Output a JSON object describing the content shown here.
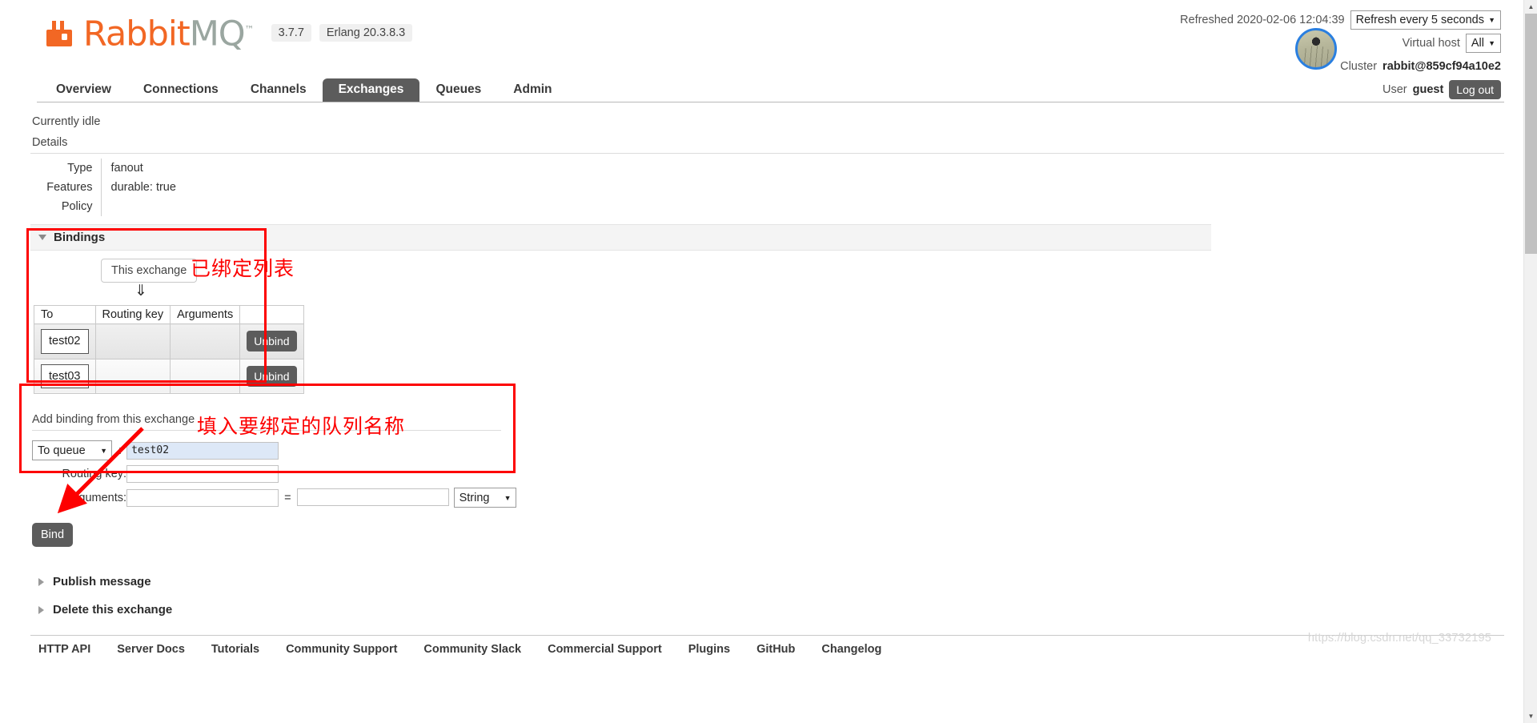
{
  "header": {
    "logo_rabbit": "Rabbit",
    "logo_mq": "MQ",
    "logo_tm": "™",
    "version": "3.7.7",
    "erlang": "Erlang 20.3.8.3",
    "refreshed_label": "Refreshed 2020-02-06 12:04:39",
    "refresh_select": "Refresh every 5 seconds",
    "vhost_label": "Virtual host",
    "vhost_select": "All",
    "cluster_label": "Cluster",
    "cluster_value": "rabbit@859cf94a10e2",
    "user_label": "User",
    "user_value": "guest",
    "logout_label": "Log out"
  },
  "nav": {
    "tabs": [
      {
        "label": "Overview",
        "active": false
      },
      {
        "label": "Connections",
        "active": false
      },
      {
        "label": "Channels",
        "active": false
      },
      {
        "label": "Exchanges",
        "active": true
      },
      {
        "label": "Queues",
        "active": false
      },
      {
        "label": "Admin",
        "active": false
      }
    ]
  },
  "main": {
    "status": "Currently idle",
    "details_heading": "Details",
    "details": [
      {
        "key": "Type",
        "value": "fanout"
      },
      {
        "key": "Features",
        "value": "durable: true"
      },
      {
        "key": "Policy",
        "value": ""
      }
    ],
    "features_key": "durable:",
    "features_val": "true"
  },
  "bindings": {
    "section_label": "Bindings",
    "this_exchange": "This exchange",
    "arrow_glyph": "⇓",
    "columns": [
      "To",
      "Routing key",
      "Arguments",
      ""
    ],
    "rows": [
      {
        "to": "test02",
        "routing_key": "",
        "arguments": "",
        "action": "Unbind"
      },
      {
        "to": "test03",
        "routing_key": "",
        "arguments": "",
        "action": "Unbind"
      }
    ]
  },
  "add_binding": {
    "title": "Add binding from this exchange",
    "destination_select": "To queue",
    "colon": ":",
    "destination_value": "test02",
    "routing_key_label": "Routing key:",
    "routing_key_value": "",
    "arguments_label": "Arguments:",
    "argument_key_value": "",
    "equals": "=",
    "argument_val_value": "",
    "type_select": "String",
    "bind_label": "Bind"
  },
  "sections": [
    {
      "label": "Publish message"
    },
    {
      "label": "Delete this exchange"
    }
  ],
  "annotations": {
    "bound_list": "已绑定列表",
    "fill_queue_name": "填入要绑定的队列名称",
    "color": "#fd0000"
  },
  "footer": {
    "links": [
      "HTTP API",
      "Server Docs",
      "Tutorials",
      "Community Support",
      "Community Slack",
      "Commercial Support",
      "Plugins",
      "GitHub",
      "Changelog"
    ],
    "watermark": "https://blog.csdn.net/qq_33732195"
  }
}
